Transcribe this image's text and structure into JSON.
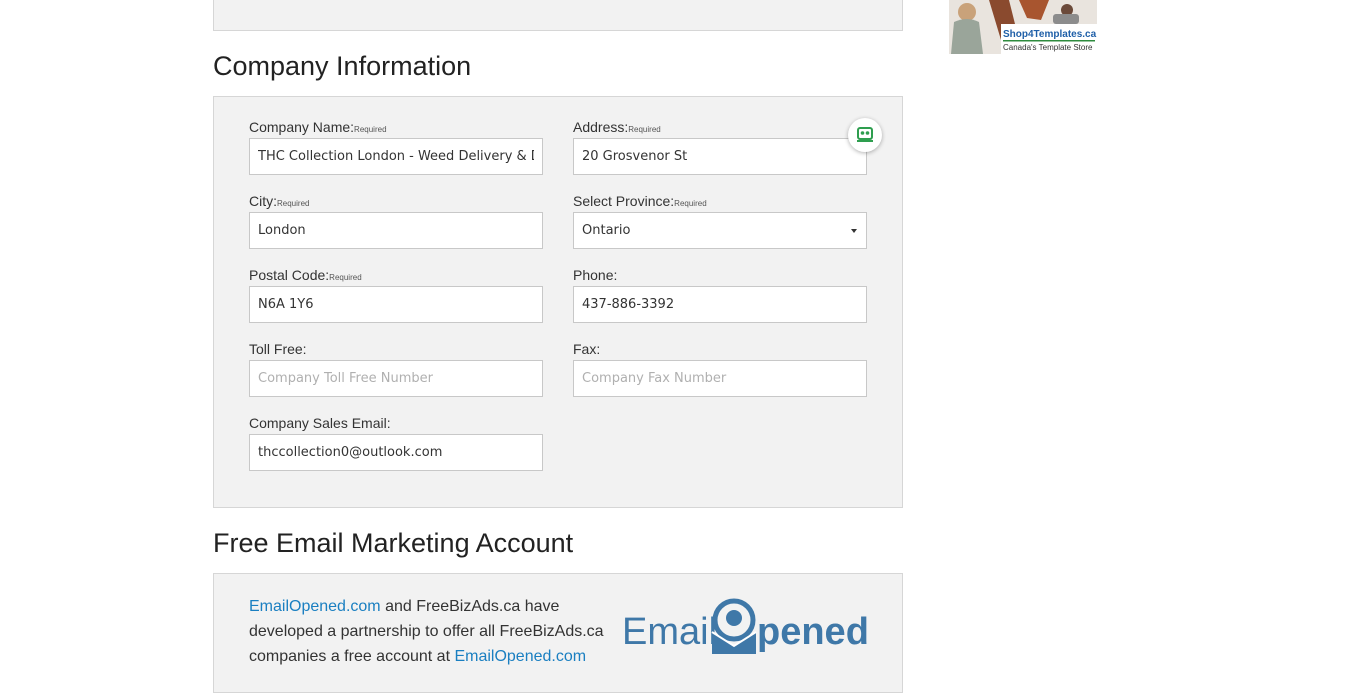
{
  "ad": {
    "brand": "Shop4Templates.ca",
    "tagline": "Canada's Template Store"
  },
  "company_section": {
    "title": "Company Information",
    "required_tag": "Required",
    "fields": {
      "company_name": {
        "label": "Company Name:",
        "value": "THC Collection London - Weed Delivery & D"
      },
      "address": {
        "label": "Address:",
        "value": "20 Grosvenor St"
      },
      "city": {
        "label": "City:",
        "value": "London"
      },
      "province": {
        "label": "Select Province:",
        "value": "Ontario"
      },
      "postal_code": {
        "label": "Postal Code:",
        "value": "N6A 1Y6"
      },
      "phone": {
        "label": "Phone:",
        "value": "437-886-3392"
      },
      "toll_free": {
        "label": "Toll Free:",
        "value": "",
        "placeholder": "Company Toll Free Number"
      },
      "fax": {
        "label": "Fax:",
        "value": "",
        "placeholder": "Company Fax Number"
      },
      "sales_email": {
        "label": "Company Sales Email:",
        "value": "thccollection0@outlook.com"
      }
    }
  },
  "email_section": {
    "title": "Free Email Marketing Account",
    "text": {
      "link1": "EmailOpened.com",
      "part1": " and FreeBizAds.ca have developed a partnership to offer all FreeBizAds.ca companies a free account at ",
      "link2": "EmailOpened.com"
    },
    "logo": {
      "left": "Email",
      "right": "pened"
    }
  },
  "colors": {
    "link": "#1a7fc1",
    "logo": "#3f78a8",
    "password_manager": "#2e9e4f"
  }
}
